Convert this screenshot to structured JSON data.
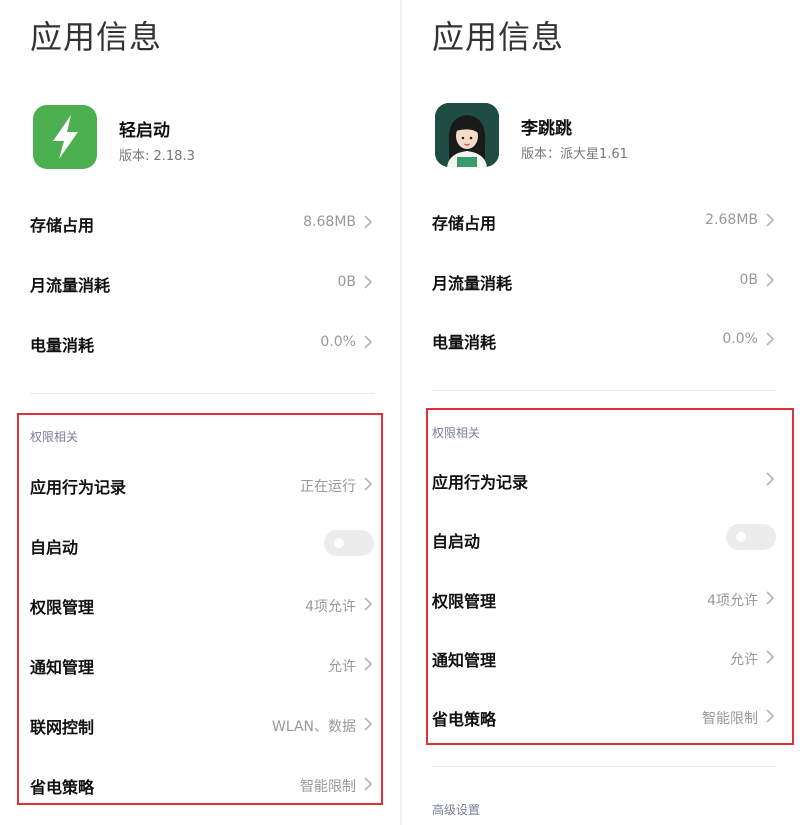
{
  "left": {
    "page_title": "应用信息",
    "app": {
      "name": "轻启动",
      "version": "版本: 2.18.3",
      "icon": "lightning-bolt-icon",
      "icon_color": "#4caf50"
    },
    "rows": [
      {
        "label": "存储占用",
        "value": "8.68MB"
      },
      {
        "label": "月流量消耗",
        "value": "0B"
      },
      {
        "label": "电量消耗",
        "value": "0.0%"
      }
    ],
    "permissions": {
      "header": "权限相关",
      "app_behavior": {
        "label": "应用行为记录",
        "value": "正在运行"
      },
      "autostart": {
        "label": "自启动",
        "enabled": false
      },
      "permission_mgmt": {
        "label": "权限管理",
        "value": "4项允许"
      },
      "notification_mgmt": {
        "label": "通知管理",
        "value": "允许"
      },
      "network_control": {
        "label": "联网控制",
        "value": "WLAN、数据"
      },
      "power_policy": {
        "label": "省电策略",
        "value": "智能限制"
      }
    }
  },
  "right": {
    "page_title": "应用信息",
    "app": {
      "name": "李跳跳",
      "version": "版本：派大星1.61",
      "icon": "girl-avatar-icon",
      "icon_color": "#1f4d43"
    },
    "rows": [
      {
        "label": "存储占用",
        "value": "2.68MB"
      },
      {
        "label": "月流量消耗",
        "value": "0B"
      },
      {
        "label": "电量消耗",
        "value": "0.0%"
      }
    ],
    "permissions": {
      "header": "权限相关",
      "app_behavior": {
        "label": "应用行为记录",
        "value": ""
      },
      "autostart": {
        "label": "自启动",
        "enabled": false
      },
      "permission_mgmt": {
        "label": "权限管理",
        "value": "4项允许"
      },
      "notification_mgmt": {
        "label": "通知管理",
        "value": "允许"
      },
      "power_policy": {
        "label": "省电策略",
        "value": "智能限制"
      }
    },
    "advanced_header": "高级设置"
  },
  "colors": {
    "highlight_border": "#e0313b",
    "section_header": "#7a7f9a",
    "toggle_off": "#ececec"
  }
}
